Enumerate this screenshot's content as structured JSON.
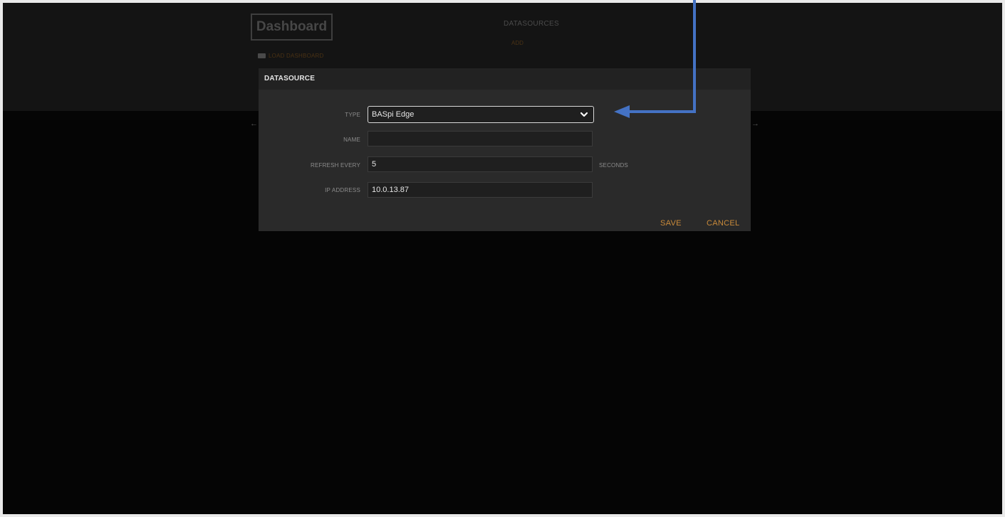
{
  "app": {
    "dashboard_title": "Dashboard",
    "load_dashboard": "LOAD DASHBOARD",
    "datasources_header": "DATASOURCES",
    "datasources_add": "ADD",
    "arrow_left_glyph": "←",
    "arrow_right_glyph": "→"
  },
  "modal": {
    "title": "DATASOURCE",
    "fields": {
      "type": {
        "label": "TYPE",
        "value": "BASpi Edge"
      },
      "name": {
        "label": "NAME",
        "value": ""
      },
      "refresh": {
        "label": "REFRESH EVERY",
        "value": "5",
        "unit": "SECONDS"
      },
      "ip": {
        "label": "IP ADDRESS",
        "value": "10.0.13.87"
      }
    },
    "buttons": {
      "save": "SAVE",
      "cancel": "CANCEL"
    }
  },
  "colors": {
    "accent": "#c98a3a",
    "annotation": "#4472c4",
    "modal_bg": "#2a2a2a",
    "page_bg": "#050505"
  },
  "icons": {
    "type_select": "chevron-down-icon",
    "load_dashboard": "folder-icon",
    "annotation": "annotation-arrow-icon"
  }
}
